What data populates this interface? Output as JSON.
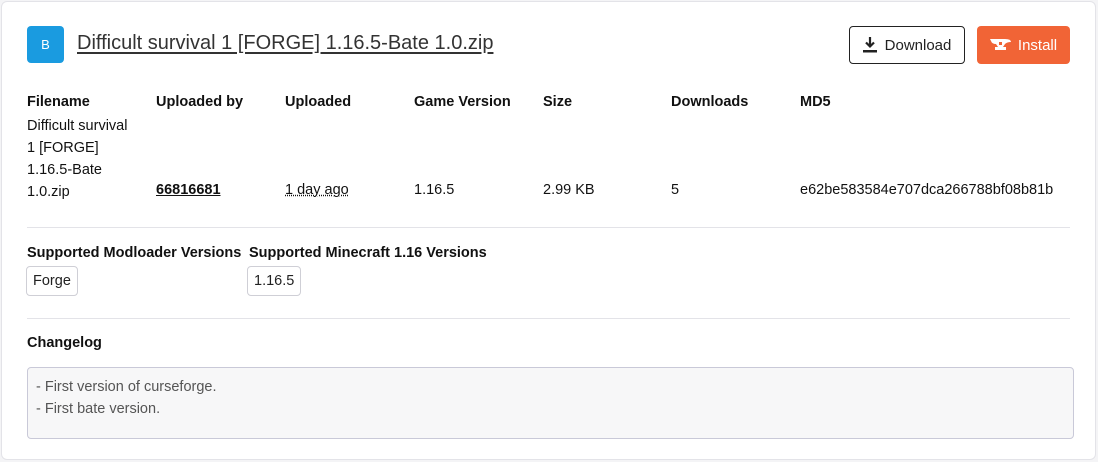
{
  "header": {
    "badge_letter": "B",
    "title": "Difficult survival 1 [FORGE] 1.16.5-Bate 1.0.zip",
    "download_label": "Download",
    "install_label": "Install"
  },
  "details": {
    "headers": {
      "filename": "Filename",
      "uploaded_by": "Uploaded by",
      "uploaded": "Uploaded",
      "game_version": "Game Version",
      "size": "Size",
      "downloads": "Downloads",
      "md5": "MD5"
    },
    "values": {
      "filename": "Difficult survival 1 [FORGE] 1.16.5-Bate 1.0.zip",
      "uploaded_by": "66816681",
      "uploaded": "1 day ago",
      "game_version": "1.16.5",
      "size": "2.99 KB",
      "downloads": "5",
      "md5": "e62be583584e707dca266788bf08b81b"
    }
  },
  "supported": {
    "modloader_heading": "Supported Modloader Versions",
    "modloader_tags": [
      "Forge"
    ],
    "minecraft_heading": "Supported Minecraft 1.16 Versions",
    "minecraft_tags": [
      "1.16.5"
    ]
  },
  "changelog": {
    "heading": "Changelog",
    "lines": [
      "- First version of curseforge.",
      "- First bate version."
    ]
  },
  "colors": {
    "badge": "#1a9be0",
    "install": "#f16436"
  }
}
